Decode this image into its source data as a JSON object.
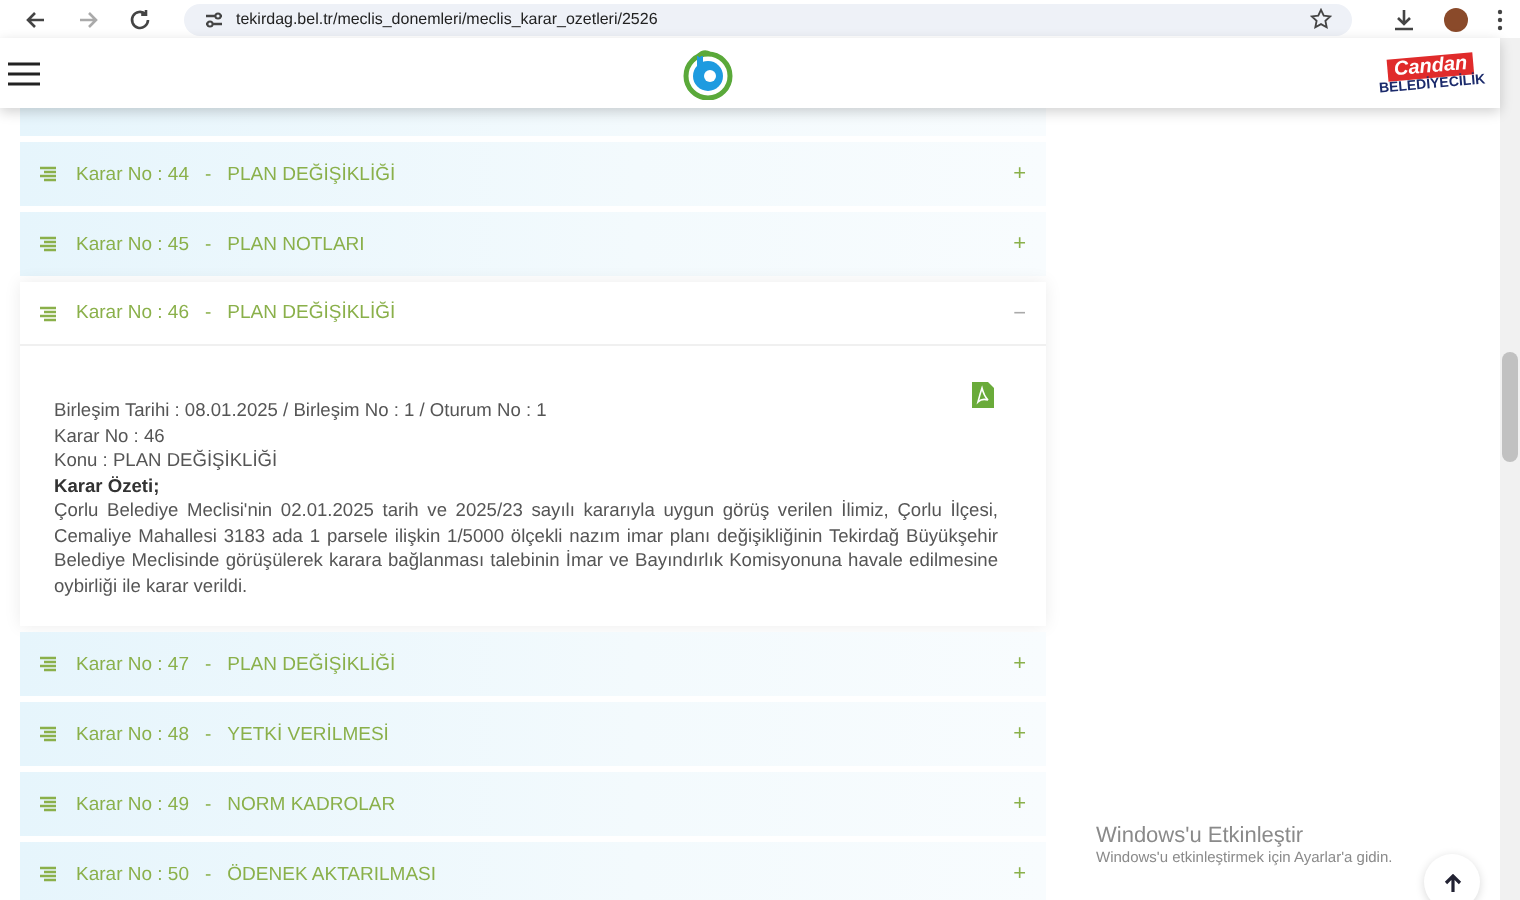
{
  "browser": {
    "url": "tekirdag.bel.tr/meclis_donemleri/meclis_karar_ozetleri/2526"
  },
  "header": {
    "badge_top": "Candan",
    "badge_bottom": "BELEDİYECİLİK"
  },
  "decisions": [
    {
      "label": "Karar No : 44",
      "separator": "-",
      "subject": "PLAN DEĞİŞİKLİĞİ",
      "expanded": false,
      "toggle": "+"
    },
    {
      "label": "Karar No : 45",
      "separator": "-",
      "subject": "PLAN NOTLARI",
      "expanded": false,
      "toggle": "+"
    },
    {
      "label": "Karar No : 46",
      "separator": "-",
      "subject": "PLAN DEĞİŞİKLİĞİ",
      "expanded": true,
      "toggle": "−",
      "details": {
        "meta": [
          "Birleşim Tarihi : 08.01.2025 / Birleşim No : 1 / Oturum No : 1",
          "Karar No : 46",
          "Konu : PLAN DEĞİŞİKLİĞİ"
        ],
        "summary_title": "Karar Özeti;",
        "summary": "Çorlu Belediye Meclisi'nin 02.01.2025 tarih ve 2025/23 sayılı kararıyla uygun görüş verilen İlimiz, Çorlu İlçesi, Cemaliye Mahallesi 3183 ada 1 parsele ilişkin 1/5000 ölçekli nazım imar planı değişikliğinin Tekirdağ Büyükşehir Belediye Meclisinde görüşülerek karara bağlanması talebinin İmar ve Bayındırlık Komisyonuna havale edilmesine oybirliği ile karar verildi."
      }
    },
    {
      "label": "Karar No : 47",
      "separator": "-",
      "subject": "PLAN DEĞİŞİKLİĞİ",
      "expanded": false,
      "toggle": "+"
    },
    {
      "label": "Karar No : 48",
      "separator": "-",
      "subject": "YETKİ VERİLMESİ",
      "expanded": false,
      "toggle": "+"
    },
    {
      "label": "Karar No : 49",
      "separator": "-",
      "subject": "NORM KADROLAR",
      "expanded": false,
      "toggle": "+"
    },
    {
      "label": "Karar No : 50",
      "separator": "-",
      "subject": "ÖDENEK AKTARILMASI",
      "expanded": false,
      "toggle": "+"
    }
  ],
  "windows_notice": {
    "title": "Windows'u Etkinleştir",
    "text": "Windows'u etkinleştirmek için Ayarlar'a gidin."
  }
}
